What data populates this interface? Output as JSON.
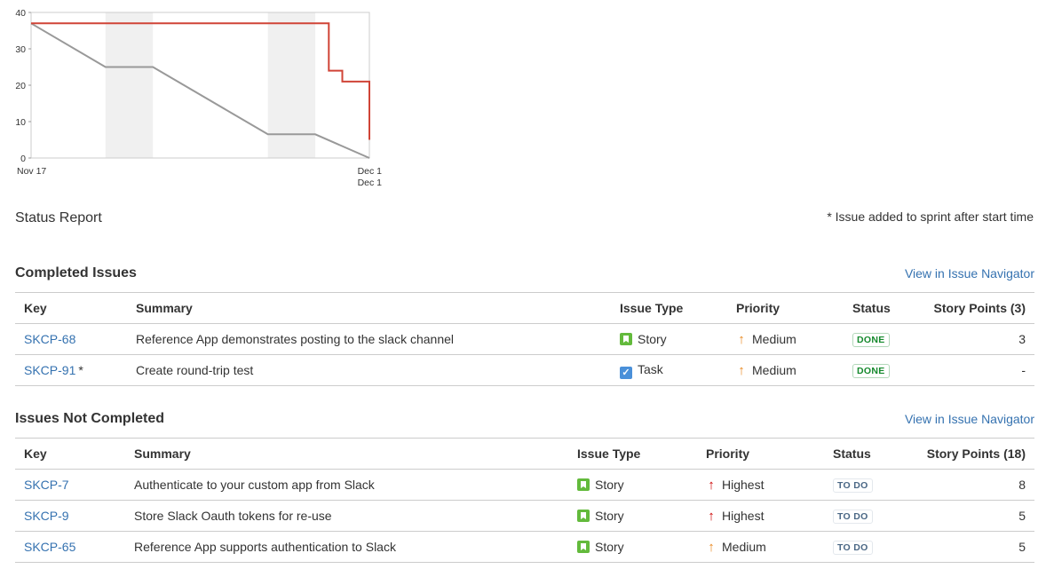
{
  "chart_data": {
    "type": "line",
    "x_ticks": [
      "Nov 17",
      "Dec 1",
      "Dec 1"
    ],
    "y_ticks": [
      "0",
      "10",
      "20",
      "30",
      "40"
    ],
    "ylim": [
      0,
      40
    ],
    "grid": false,
    "non_working_bands": [
      [
        2.2,
        3.6
      ],
      [
        7.0,
        8.4
      ]
    ],
    "series": [
      {
        "color": "#d04437",
        "points": [
          [
            0,
            37
          ],
          [
            8.8,
            37
          ],
          [
            8.8,
            24
          ],
          [
            9.2,
            24
          ],
          [
            9.2,
            21
          ],
          [
            10,
            21
          ],
          [
            10,
            5
          ]
        ]
      },
      {
        "color": "#999999",
        "points": [
          [
            0,
            37
          ],
          [
            2.2,
            25
          ],
          [
            3.6,
            25
          ],
          [
            7.0,
            6.5
          ],
          [
            8.4,
            6.5
          ],
          [
            10,
            0
          ]
        ]
      }
    ]
  },
  "status_report": {
    "title": "Status Report",
    "footnote": "* Issue added to sprint after start time"
  },
  "completed": {
    "title": "Completed Issues",
    "link": "View in Issue Navigator",
    "headers": {
      "key": "Key",
      "summary": "Summary",
      "type": "Issue Type",
      "priority": "Priority",
      "status": "Status",
      "points": "Story Points (3)"
    },
    "rows": [
      {
        "key": "SKCP-68",
        "asterisk": "",
        "summary": "Reference App demonstrates posting to the slack channel",
        "type": "Story",
        "type_icon": "story-icon",
        "priority": "Medium",
        "priority_icon": "arrow-up-icon",
        "priority_color": "#e8871e",
        "status": "DONE",
        "points": "3"
      },
      {
        "key": "SKCP-91",
        "asterisk": "*",
        "summary": "Create round-trip test",
        "type": "Task",
        "type_icon": "task-icon",
        "priority": "Medium",
        "priority_icon": "arrow-up-icon",
        "priority_color": "#e8871e",
        "status": "DONE",
        "points": "-"
      }
    ]
  },
  "not_completed": {
    "title": "Issues Not Completed",
    "link": "View in Issue Navigator",
    "headers": {
      "key": "Key",
      "summary": "Summary",
      "type": "Issue Type",
      "priority": "Priority",
      "status": "Status",
      "points": "Story Points (18)"
    },
    "rows": [
      {
        "key": "SKCP-7",
        "asterisk": "",
        "summary": "Authenticate to your custom app from Slack",
        "type": "Story",
        "type_icon": "story-icon",
        "priority": "Highest",
        "priority_icon": "arrow-up-icon",
        "priority_color": "#cc0000",
        "status": "TO DO",
        "points": "8"
      },
      {
        "key": "SKCP-9",
        "asterisk": "",
        "summary": "Store Slack Oauth tokens for re-use",
        "type": "Story",
        "type_icon": "story-icon",
        "priority": "Highest",
        "priority_icon": "arrow-up-icon",
        "priority_color": "#cc0000",
        "status": "TO DO",
        "points": "5"
      },
      {
        "key": "SKCP-65",
        "asterisk": "",
        "summary": "Reference App supports authentication to Slack",
        "type": "Story",
        "type_icon": "story-icon",
        "priority": "Medium",
        "priority_icon": "arrow-up-icon",
        "priority_color": "#e8871e",
        "status": "TO DO",
        "points": "5"
      }
    ]
  },
  "colors": {
    "link": "#3572b0",
    "done_text": "#14892c",
    "done_border": "#b2d8b9",
    "todo_text": "#4a6785",
    "todo_border": "#e4e8ed"
  }
}
